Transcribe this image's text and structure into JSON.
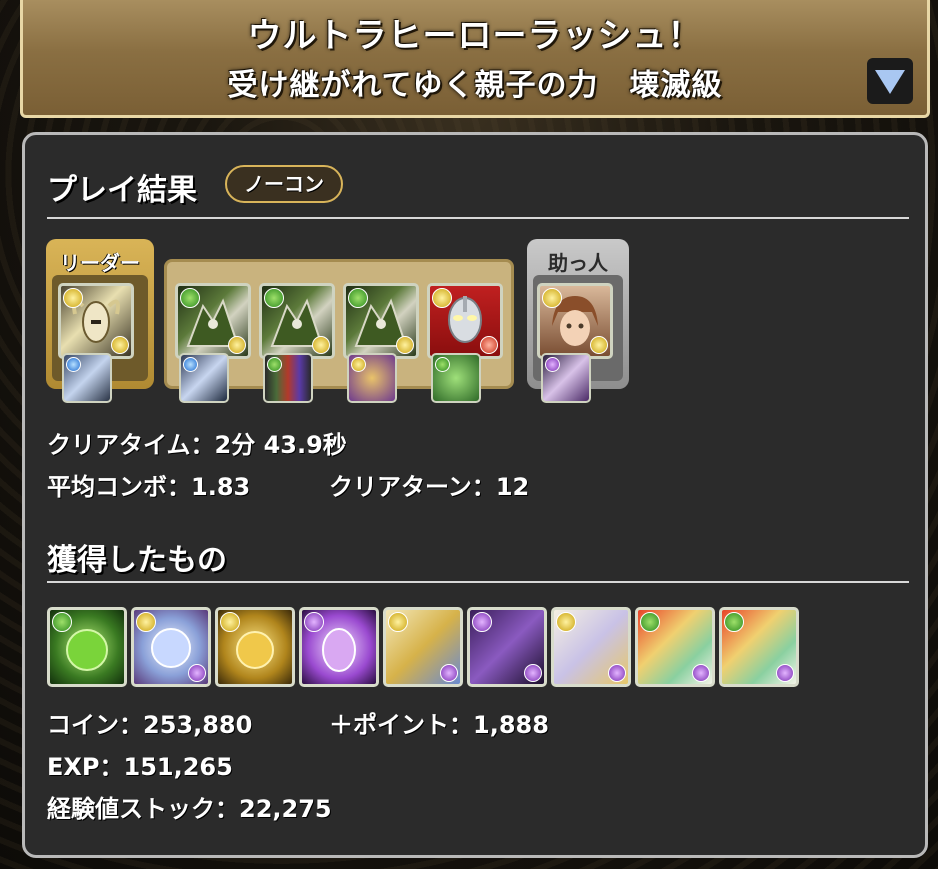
{
  "header": {
    "dungeon_title": "ウルトラヒーローラッシュ！",
    "floor_title": "受け継がれてゆく親子の力　壊滅級",
    "dropdown_icon": "triangle-down-icon"
  },
  "play_result": {
    "section_title": "プレイ結果",
    "badge_label": "ノーコン",
    "leader_label": "リーダー",
    "helper_label": "助っ人",
    "clear_time_label": "クリアタイム：",
    "clear_time_value": "2分 43.9秒",
    "avg_combo_label": "平均コンボ：",
    "avg_combo_value": "1.83",
    "clear_turn_label": "クリアターン：",
    "clear_turn_value": "12"
  },
  "team": {
    "leader": {
      "main_attr": "yellow",
      "sub_attr": "yellow",
      "assist_attr": "blue",
      "art": "golden-skull-dragon"
    },
    "subs": [
      {
        "main_attr": "green",
        "sub_attr": "yellow",
        "assist_attr": "blue",
        "art": "green-dark-dragon"
      },
      {
        "main_attr": "green",
        "sub_attr": "yellow",
        "assist_attr": "green",
        "art": "green-dark-dragon"
      },
      {
        "main_attr": "green",
        "sub_attr": "yellow",
        "assist_attr": "yellow",
        "art": "green-dark-dragon"
      },
      {
        "main_attr": "yellow",
        "sub_attr": "red",
        "assist_attr": "green",
        "art": "ultraman-hero"
      }
    ],
    "helper": {
      "main_attr": "yellow",
      "sub_attr": "yellow",
      "assist_attr": "purple",
      "art": "brown-hair-girl"
    }
  },
  "rewards": {
    "section_title": "獲得したもの",
    "drops": [
      {
        "attr": "green",
        "sub_attr": "",
        "art": "green-gem-orb"
      },
      {
        "attr": "yellow",
        "sub_attr": "purple",
        "art": "crystal-orb"
      },
      {
        "attr": "yellow",
        "sub_attr": "",
        "art": "golden-orb"
      },
      {
        "attr": "purple",
        "sub_attr": "",
        "art": "mystic-egg"
      },
      {
        "attr": "yellow",
        "sub_attr": "purple",
        "art": "fairy-character"
      },
      {
        "attr": "purple",
        "sub_attr": "purple",
        "art": "dark-witch"
      },
      {
        "attr": "yellow",
        "sub_attr": "purple",
        "art": "sheep-girl"
      },
      {
        "attr": "green",
        "sub_attr": "purple",
        "art": "tamadra-green"
      },
      {
        "attr": "green",
        "sub_attr": "purple",
        "art": "tamadra-green"
      }
    ],
    "coin_label": "コイン：",
    "coin_value": "253,880",
    "point_label": "＋ポイント：",
    "point_value": "1,888",
    "exp_label": "EXP：",
    "exp_value": "151,265",
    "exp_stock_label": "経験値ストック：",
    "exp_stock_value": "22,275"
  },
  "colors": {
    "panel_bg": "#2b2b2b",
    "title_bar_gold": "#8a6f42",
    "leader_gold": "#d9b457",
    "helper_silver": "#c9c9c9"
  }
}
